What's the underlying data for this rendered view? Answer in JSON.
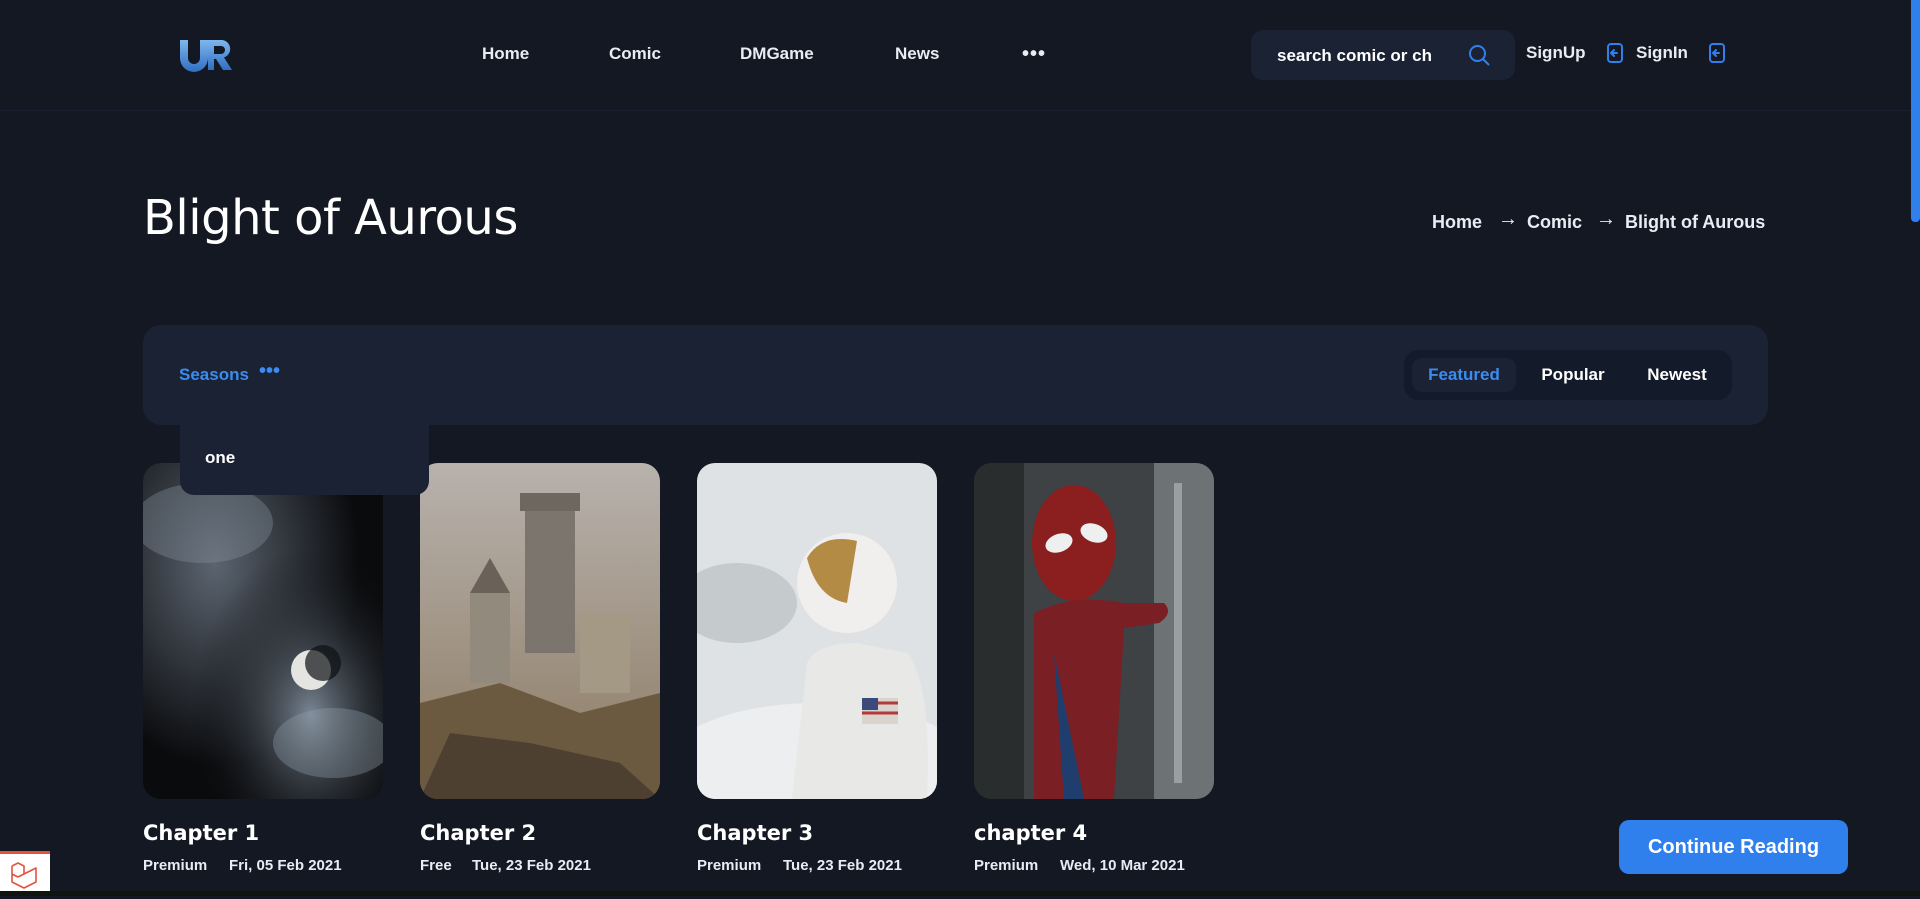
{
  "brand": {
    "logo_text": "UR",
    "accent": "#2f80ed",
    "background": "#131823",
    "panel": "#1a2234"
  },
  "nav": {
    "items": [
      "Home",
      "Comic",
      "DMGame",
      "News"
    ],
    "more_icon": "ellipsis-icon"
  },
  "search": {
    "placeholder": "search comic or ch",
    "icon": "search-icon"
  },
  "auth": {
    "signup": "SignUp",
    "signin": "SignIn",
    "icon": "sign-in-icon"
  },
  "page": {
    "title": "Blight of Aurous"
  },
  "breadcrumb": {
    "items": [
      "Home",
      "Comic",
      "Blight of Aurous"
    ],
    "separator": "→"
  },
  "filter": {
    "seasons_label": "Seasons",
    "seasons_icon": "ellipsis-icon",
    "seasons_options": [
      "one"
    ],
    "tabs": [
      "Featured",
      "Popular",
      "Newest"
    ],
    "active_tab": "Featured"
  },
  "chapters": [
    {
      "title": "Chapter 1",
      "access": "Premium",
      "date": "Fri, 05 Feb 2021",
      "image": "moon-clouds-image"
    },
    {
      "title": "Chapter 2",
      "access": "Free",
      "date": "Tue, 23 Feb 2021",
      "image": "castle-painting-image"
    },
    {
      "title": "Chapter 3",
      "access": "Premium",
      "date": "Tue, 23 Feb 2021",
      "image": "astronaut-image"
    },
    {
      "title": "chapter 4",
      "access": "Premium",
      "date": "Wed, 10 Mar 2021",
      "image": "spider-hero-image"
    }
  ],
  "continue_button": "Continue Reading"
}
